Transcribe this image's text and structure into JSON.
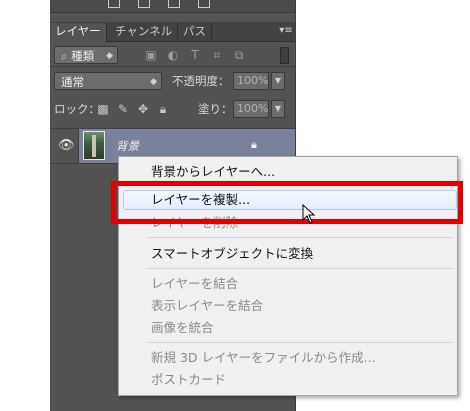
{
  "tabs": [
    "レイヤー",
    "チャンネル",
    "パス"
  ],
  "filter": {
    "label": "種類"
  },
  "blend": {
    "mode": "通常",
    "opacity_label": "不透明度：",
    "opacity_value": "100%"
  },
  "lock_row": {
    "lock_label": "ロック：",
    "fill_label": "塗り：",
    "fill_value": "100%"
  },
  "layer": {
    "name": "背景"
  },
  "context_menu": {
    "items": [
      {
        "label": "背景からレイヤーへ..."
      },
      {
        "label": "レイヤーを複製..."
      },
      {
        "label": "レイヤーを削除"
      },
      {
        "label": "スマートオブジェクトに変換"
      },
      {
        "label": "レイヤーを結合"
      },
      {
        "label": "表示レイヤーを結合"
      },
      {
        "label": "画像を統合"
      },
      {
        "label": "新規 3D レイヤーをファイルから作成..."
      },
      {
        "label": "ポストカード"
      }
    ]
  },
  "colors": {
    "panel": "#535353",
    "layer_selected": "#7a829b",
    "highlight_box": "#e00000",
    "menu_bg": "#f0f0f0"
  }
}
